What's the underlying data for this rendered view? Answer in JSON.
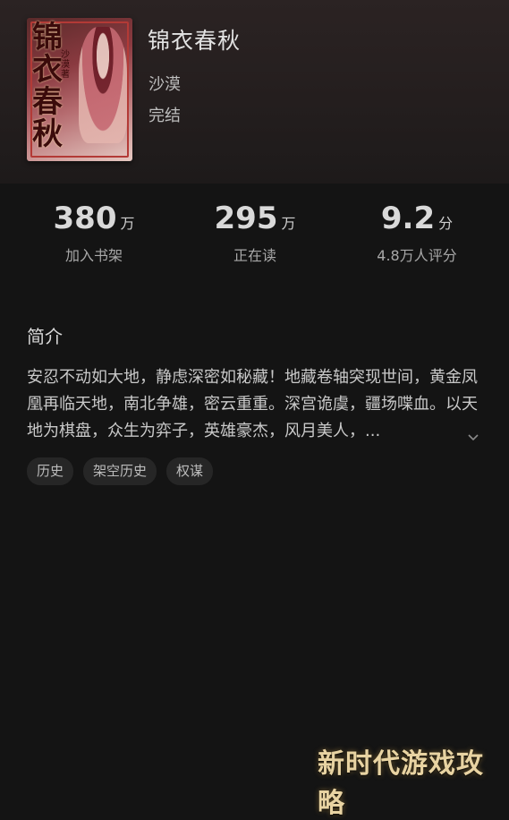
{
  "book": {
    "title": "锦衣春秋",
    "author": "沙漠",
    "status": "完结",
    "cover": {
      "calligraphy": "锦衣春秋",
      "author_mark": "沙漠著"
    }
  },
  "stats": [
    {
      "value": "380",
      "unit": "万",
      "label": "加入书架"
    },
    {
      "value": "295",
      "unit": "万",
      "label": "正在读"
    },
    {
      "value": "9.2",
      "unit": "分",
      "label": "4.8万人评分"
    }
  ],
  "intro": {
    "heading": "简介",
    "text": "安忍不动如大地，静虑深密如秘藏！地藏卷轴突现世间，黄金凤凰再临天地，南北争雄，密云重重。深宫诡虞，疆场喋血。以天地为棋盘，众生为弈子，英雄豪杰，风月美人，..."
  },
  "tags": [
    "历史",
    "架空历史",
    "权谋"
  ],
  "watermark": "新时代游戏攻略"
}
